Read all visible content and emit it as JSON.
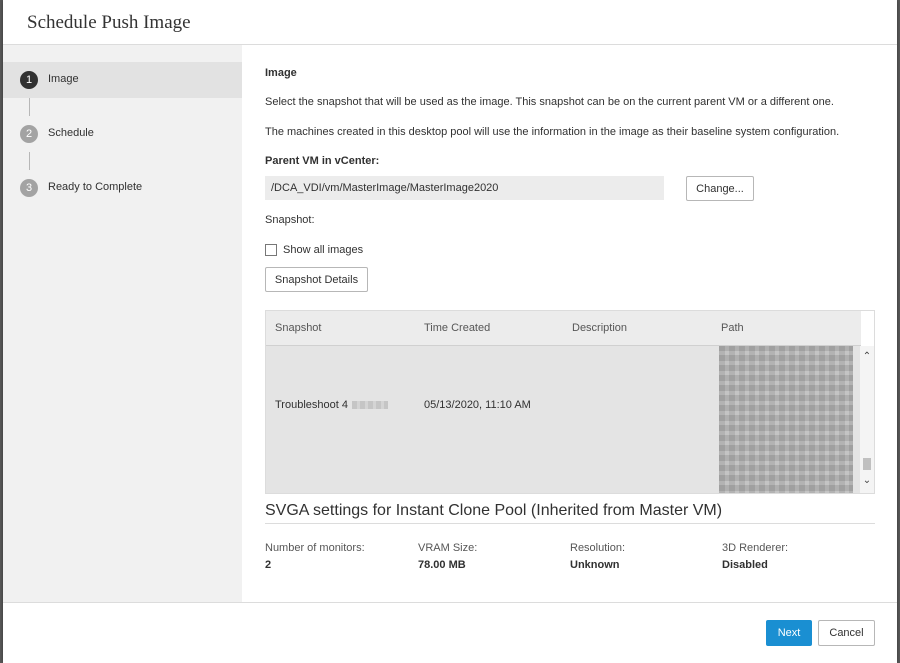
{
  "dialog": {
    "title": "Schedule Push Image"
  },
  "steps": [
    {
      "num": "1",
      "label": "Image",
      "active": true
    },
    {
      "num": "2",
      "label": "Schedule",
      "active": false
    },
    {
      "num": "3",
      "label": "Ready to Complete",
      "active": false
    }
  ],
  "image": {
    "title": "Image",
    "desc1": "Select the snapshot that will be used as the image. This snapshot can be on the current parent VM or a different one.",
    "desc2": "The machines created in this desktop pool will use the information in the image as their baseline system configuration.",
    "parent_vm_label": "Parent VM in vCenter:",
    "parent_vm_path": "/DCA_VDI/vm/MasterImage/MasterImage2020",
    "change_label": "Change...",
    "snapshot_label": "Snapshot:",
    "show_all_label": "Show all images",
    "show_all_checked": false,
    "snapshot_details_label": "Snapshot Details"
  },
  "table": {
    "columns": [
      "Snapshot",
      "Time Created",
      "Description",
      "Path"
    ],
    "rows": [
      {
        "snapshot": "Troubleshoot 4",
        "time_created": "05/13/2020, 11:10 AM",
        "description": "",
        "path": ""
      }
    ]
  },
  "svga": {
    "title": "SVGA settings for Instant Clone Pool (Inherited from Master VM)",
    "props": [
      {
        "label": "Number of monitors:",
        "value": "2"
      },
      {
        "label": "VRAM Size:",
        "value": "78.00 MB"
      },
      {
        "label": "Resolution:",
        "value": "Unknown"
      },
      {
        "label": "3D Renderer:",
        "value": "Disabled"
      }
    ]
  },
  "footer": {
    "next_label": "Next",
    "cancel_label": "Cancel"
  },
  "colors": {
    "primary": "#1a8fd2",
    "sidebar_bg": "#f1f1f1",
    "active_step_bg": "#e2e2e2"
  }
}
